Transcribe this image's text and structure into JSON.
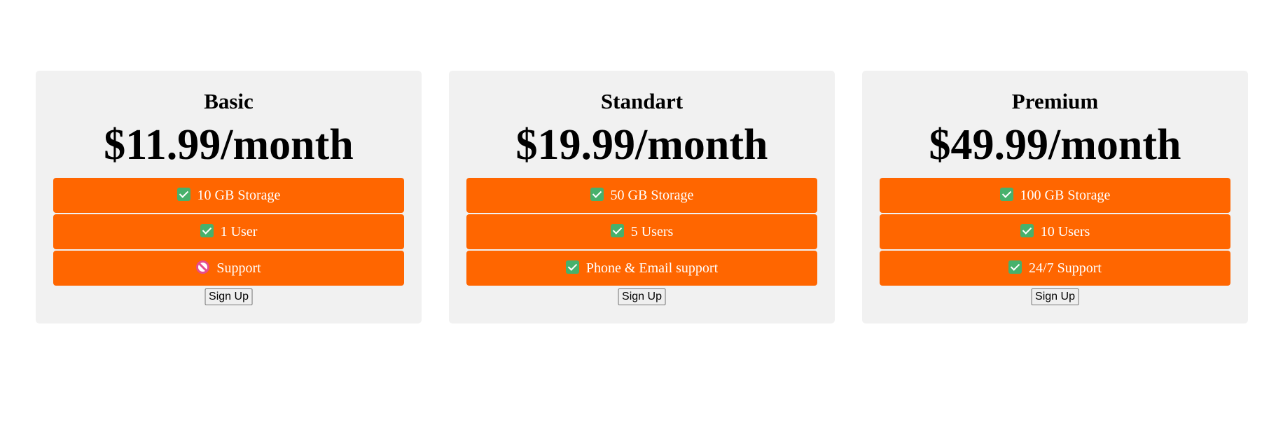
{
  "plans": [
    {
      "name": "Basic",
      "price": "$11.99/month",
      "features": [
        {
          "text": "10 GB Storage",
          "icon": "check-icon"
        },
        {
          "text": "1 User",
          "icon": "check-icon"
        },
        {
          "text": "Support",
          "icon": "prohibited-icon"
        }
      ],
      "button": "Sign Up"
    },
    {
      "name": "Standart",
      "price": "$19.99/month",
      "features": [
        {
          "text": "50 GB Storage",
          "icon": "check-icon"
        },
        {
          "text": "5 Users",
          "icon": "check-icon"
        },
        {
          "text": "Phone & Email support",
          "icon": "check-icon"
        }
      ],
      "button": "Sign Up"
    },
    {
      "name": "Premium",
      "price": "$49.99/month",
      "features": [
        {
          "text": "100 GB Storage",
          "icon": "check-icon"
        },
        {
          "text": "10 Users",
          "icon": "check-icon"
        },
        {
          "text": "24/7 Support",
          "icon": "check-icon"
        }
      ],
      "button": "Sign Up"
    }
  ],
  "colors": {
    "card_background": "#f1f1f1",
    "feature_background": "#ff6600",
    "feature_text": "#ffffff",
    "check_icon": "#47b16c",
    "prohibited_icon": "#e64d8d"
  }
}
